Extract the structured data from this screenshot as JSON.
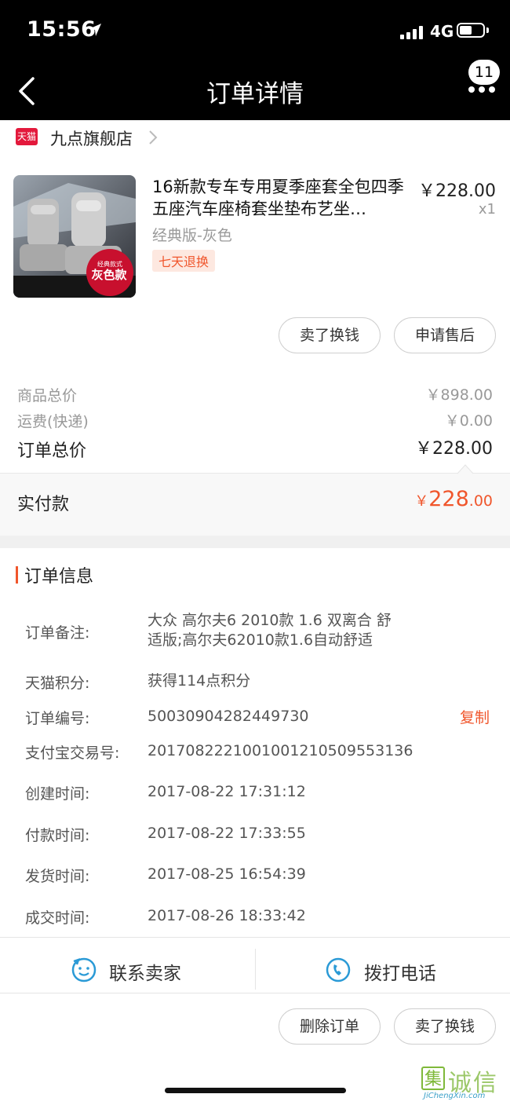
{
  "status_bar": {
    "time": "15:56",
    "network": "4G"
  },
  "nav": {
    "title": "订单详情",
    "badge": "11"
  },
  "store": {
    "logo_text": "天猫",
    "name": "九点旗舰店"
  },
  "product": {
    "title": "16新款专车专用夏季座套全包四季五座汽车座椅套坐垫布艺坐…",
    "price": "￥228.00",
    "qty": "x1",
    "sku": "经典版-灰色",
    "tag": "七天退换",
    "thumb_badge_top": "经典款式",
    "thumb_badge_main": "灰色款"
  },
  "product_actions": {
    "sell": "卖了换钱",
    "after_sale": "申请售后"
  },
  "price_summary": {
    "goods_label": "商品总价",
    "goods_value": "￥898.00",
    "shipping_label": "运费(快递)",
    "shipping_value": "￥0.00",
    "order_total_label": "订单总价",
    "order_total_value": "￥228.00",
    "paid_label": "实付款",
    "paid_currency": "￥",
    "paid_integer": "228",
    "paid_decimal": ".00"
  },
  "order_info": {
    "section_title": "订单信息",
    "remark_label": "订单备注:",
    "remark_line1": "大众 高尔夫6 2010款 1.6 双离合 舒",
    "remark_line2": "适版;高尔夫62010款1.6自动舒适",
    "points_label": "天猫积分:",
    "points_value": "获得114点积分",
    "order_no_label": "订单编号:",
    "order_no_value": "500309042824497​30",
    "alipay_label": "支付宝交易号:",
    "alipay_value": "2017082221001001210509553136",
    "created_label": "创建时间:",
    "created_value": "2017-08-22 17:31:12",
    "paid_label": "付款时间:",
    "paid_value": "2017-08-22 17:33:55",
    "shipped_label": "发货时间:",
    "shipped_value": "2017-08-25 16:54:39",
    "done_label": "成交时间:",
    "done_value": "2017-08-26 18:33:42",
    "copy": "复制"
  },
  "contact": {
    "seller": "联系卖家",
    "call": "拨打电话"
  },
  "bottom_actions": {
    "delete": "删除订单",
    "sell": "卖了换钱"
  },
  "watermark": {
    "char": "集",
    "cn": "诚信",
    "en": "JiChengXin.com"
  },
  "colors": {
    "accent": "#f0562c",
    "tmall_red": "#e3193c",
    "contact_blue": "#2a9ad6"
  }
}
